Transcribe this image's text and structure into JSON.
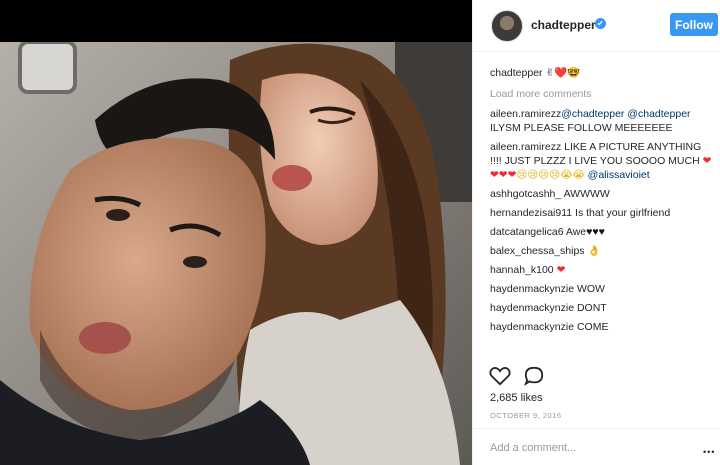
{
  "post": {
    "photo_alt": "Selfie of a man and a woman making kissing faces",
    "username": "chadtepper",
    "verified_glyph": "✔",
    "follow_label": "Follow",
    "caption": {
      "username": "chadtepper",
      "emojis": "✌❤️🤓"
    },
    "load_more_label": "Load more comments",
    "comments": [
      {
        "user": "aileen.ramirezz",
        "parts": [
          {
            "t": "mention",
            "v": "@chadtepper"
          },
          {
            "t": "text",
            "v": " "
          },
          {
            "t": "mention",
            "v": "@chadtepper"
          },
          {
            "t": "text",
            "v": " ILYSM PLEASE FOLLOW MEEEEEEE"
          }
        ]
      },
      {
        "user": "aileen.ramirezz",
        "parts": [
          {
            "t": "text",
            "v": " LIKE A PICTURE ANYTHING !!!! JUST PLZZZ I LIVE YOU SOOOO MUCH "
          },
          {
            "t": "heart",
            "v": "❤❤❤❤"
          },
          {
            "t": "face",
            "v": "😢😢😢😢😭😭"
          },
          {
            "t": "text",
            "v": " "
          },
          {
            "t": "mention",
            "v": "@alissavioiet"
          }
        ]
      },
      {
        "user": "ashhgotcashh_",
        "parts": [
          {
            "t": "text",
            "v": " AWWWW"
          }
        ]
      },
      {
        "user": "hernandezisai911",
        "parts": [
          {
            "t": "text",
            "v": " Is that your girlfriend"
          }
        ]
      },
      {
        "user": "datcatangelica6",
        "parts": [
          {
            "t": "text",
            "v": " Awe"
          },
          {
            "t": "black",
            "v": "♥♥♥"
          }
        ]
      },
      {
        "user": "balex_chessa_ships",
        "parts": [
          {
            "t": "text",
            "v": " "
          },
          {
            "t": "face",
            "v": "👌"
          }
        ]
      },
      {
        "user": "hannah_k100",
        "parts": [
          {
            "t": "text",
            "v": " "
          },
          {
            "t": "heart",
            "v": "❤"
          }
        ]
      },
      {
        "user": "haydenmackynzie",
        "parts": [
          {
            "t": "text",
            "v": " WOW"
          }
        ]
      },
      {
        "user": "haydenmackynzie",
        "parts": [
          {
            "t": "text",
            "v": " DONT"
          }
        ]
      },
      {
        "user": "haydenmackynzie",
        "parts": [
          {
            "t": "text",
            "v": " COME"
          }
        ]
      }
    ],
    "likes_label": "2,685 likes",
    "date_label": "OCTOBER 9, 2016",
    "add_comment_placeholder": "Add a comment...",
    "more_glyph": "•••"
  },
  "colors": {
    "accent": "#3897f0",
    "mention": "#003569",
    "muted": "#999999",
    "heart": "#ed2a35"
  },
  "icons": {
    "like": "heart-outline-icon",
    "comment": "speech-bubble-icon",
    "verified": "verified-badge-icon",
    "more": "ellipsis-icon"
  }
}
